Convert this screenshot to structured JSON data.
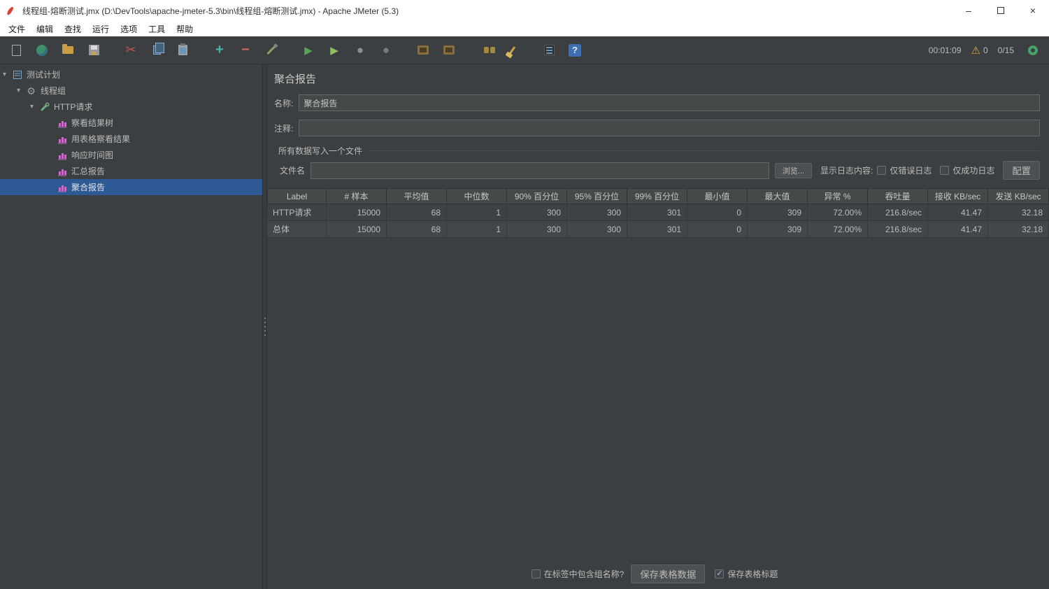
{
  "window": {
    "title": "线程组-熔断测试.jmx (D:\\DevTools\\apache-jmeter-5.3\\bin\\线程组-熔断测试.jmx) - Apache JMeter (5.3)",
    "controls": {
      "minimize": "–",
      "close": "×"
    }
  },
  "menu": {
    "items": [
      "文件",
      "编辑",
      "查找",
      "运行",
      "选项",
      "工具",
      "帮助"
    ]
  },
  "toolbar": {
    "icon_names": [
      "new-file",
      "templates",
      "open-file",
      "save",
      "cut",
      "copy",
      "paste",
      "add-element",
      "remove-element",
      "toggle-element",
      "start",
      "start-no-pauses",
      "stop",
      "shutdown",
      "remote-start-all",
      "remote-shutdown-all",
      "search",
      "clear-all",
      "function-helper",
      "help"
    ],
    "glyphs": {
      "cut": "✂",
      "plus": "+",
      "minus": "−",
      "start": "▶",
      "start2": "▶",
      "stop": "●",
      "shutdown": "●",
      "help": "?",
      "warning": "⚠"
    },
    "timer": "00:01:09",
    "warning_count": "0",
    "threads": "0/15"
  },
  "tree": {
    "items": [
      {
        "label": "测试计划",
        "depth": 0,
        "icon": "test-plan",
        "expanded": true
      },
      {
        "label": "线程组",
        "depth": 1,
        "icon": "thread-group",
        "expanded": true
      },
      {
        "label": "HTTP请求",
        "depth": 2,
        "icon": "http-request",
        "expanded": true
      },
      {
        "label": "察看结果树",
        "depth": 3,
        "icon": "listener"
      },
      {
        "label": "用表格察看结果",
        "depth": 3,
        "icon": "listener"
      },
      {
        "label": "响应时间图",
        "depth": 3,
        "icon": "listener"
      },
      {
        "label": "汇总报告",
        "depth": 3,
        "icon": "listener"
      },
      {
        "label": "聚合报告",
        "depth": 3,
        "icon": "listener",
        "selected": true
      }
    ]
  },
  "main": {
    "title": "聚合报告",
    "name_label": "名称:",
    "name_value": "聚合报告",
    "comment_label": "注释:",
    "comment_value": "",
    "file_section": {
      "title": "所有数据写入一个文件",
      "filename_label": "文件名",
      "filename_value": "",
      "browse_button": "浏览...",
      "log_display_label": "显示日志内容:",
      "errors_only": "仅错误日志",
      "errors_only_checked": false,
      "success_only": "仅成功日志",
      "success_only_checked": false,
      "configure_button": "配置"
    },
    "table": {
      "headers": [
        "Label",
        "# 样本",
        "平均值",
        "中位数",
        "90% 百分位",
        "95% 百分位",
        "99% 百分位",
        "最小值",
        "最大值",
        "异常 %",
        "吞吐量",
        "接收 KB/sec",
        "发送 KB/sec"
      ],
      "rows": [
        [
          "HTTP请求",
          "15000",
          "68",
          "1",
          "300",
          "300",
          "301",
          "0",
          "309",
          "72.00%",
          "216.8/sec",
          "41.47",
          "32.18"
        ],
        [
          "总体",
          "15000",
          "68",
          "1",
          "300",
          "300",
          "301",
          "0",
          "309",
          "72.00%",
          "216.8/sec",
          "41.47",
          "32.18"
        ]
      ]
    },
    "footer": {
      "include_group_label": "在标签中包含组名称?",
      "include_group_checked": false,
      "save_table_button": "保存表格数据",
      "save_header_label": "保存表格标题",
      "save_header_checked": true
    }
  },
  "colors": {
    "panel_bg": "#3c3f41",
    "field_bg": "#45494a",
    "selection_blue": "#2d5a94",
    "start_green": "#52a852",
    "warning_yellow": "#e2a72e",
    "listener_pink": "#c86ec8"
  }
}
